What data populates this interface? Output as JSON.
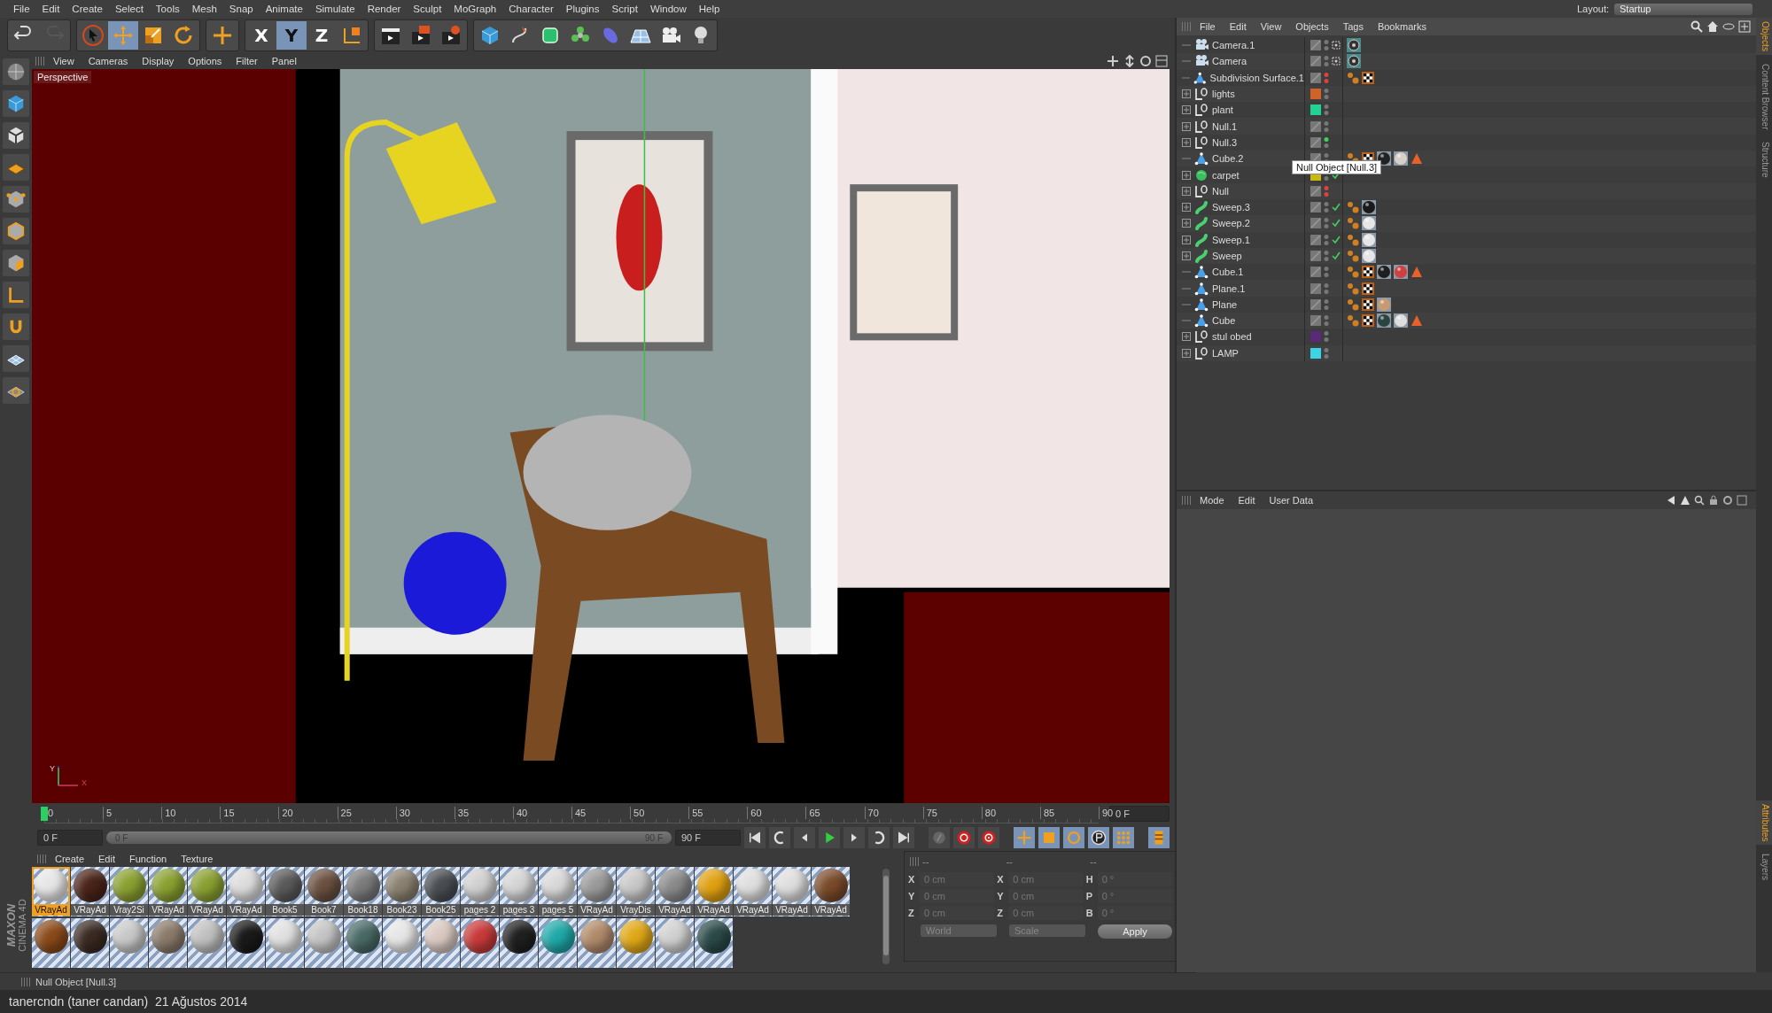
{
  "menubar": {
    "items": [
      "File",
      "Edit",
      "Create",
      "Select",
      "Tools",
      "Mesh",
      "Snap",
      "Animate",
      "Simulate",
      "Render",
      "Sculpt",
      "MoGraph",
      "Character",
      "Plugins",
      "Script",
      "Window",
      "Help"
    ],
    "layout_label": "Layout:",
    "layout_value": "Startup"
  },
  "toolbar": [
    {
      "kind": "undo",
      "selected": false,
      "disabled": false
    },
    {
      "kind": "redo",
      "selected": false,
      "disabled": true
    },
    {
      "kind": "sep"
    },
    {
      "kind": "select",
      "selected": false,
      "disabled": false
    },
    {
      "kind": "move",
      "selected": true,
      "disabled": false
    },
    {
      "kind": "scale",
      "selected": false,
      "disabled": false
    },
    {
      "kind": "rotate",
      "selected": false,
      "disabled": false
    },
    {
      "kind": "sep"
    },
    {
      "kind": "add",
      "selected": false,
      "disabled": false
    },
    {
      "kind": "sep"
    },
    {
      "kind": "axis",
      "label": "X",
      "selected": false,
      "disabled": false
    },
    {
      "kind": "axis",
      "label": "Y",
      "selected": true,
      "disabled": false
    },
    {
      "kind": "axis",
      "label": "Z",
      "selected": false,
      "disabled": false
    },
    {
      "kind": "coords",
      "selected": false,
      "disabled": false
    },
    {
      "kind": "sep"
    },
    {
      "kind": "render-view",
      "selected": false,
      "disabled": false
    },
    {
      "kind": "render-picture",
      "selected": false,
      "disabled": false
    },
    {
      "kind": "render-settings",
      "selected": false,
      "disabled": false
    },
    {
      "kind": "sep"
    },
    {
      "kind": "cube",
      "selected": false,
      "disabled": false
    },
    {
      "kind": "pen",
      "selected": false,
      "disabled": false
    },
    {
      "kind": "subdiv",
      "selected": false,
      "disabled": false
    },
    {
      "kind": "cloner",
      "selected": false,
      "disabled": false
    },
    {
      "kind": "deformer",
      "selected": false,
      "disabled": false
    },
    {
      "kind": "floor",
      "selected": false,
      "disabled": false
    },
    {
      "kind": "camera",
      "selected": false,
      "disabled": false
    },
    {
      "kind": "light",
      "selected": false,
      "disabled": false
    }
  ],
  "left_tools": [
    {
      "kind": "model"
    },
    {
      "kind": "cube"
    },
    {
      "kind": "texture"
    },
    {
      "kind": "workplane"
    },
    {
      "kind": "points"
    },
    {
      "kind": "edges"
    },
    {
      "kind": "polygons"
    },
    {
      "kind": "axis-l"
    },
    {
      "kind": "magnet"
    },
    {
      "kind": "snap"
    },
    {
      "kind": "lock"
    }
  ],
  "logo": {
    "line_1": "MAXON",
    "line_2": "CINEMA 4D"
  },
  "viewport": {
    "menu": [
      "View",
      "Cameras",
      "Display",
      "Options",
      "Filter",
      "Panel"
    ],
    "label": "Perspective",
    "axis": {
      "y": "Y",
      "x": "X"
    },
    "kind": "picture"
  },
  "timeline": {
    "ticks": [
      "0",
      "5",
      "10",
      "15",
      "20",
      "25",
      "30",
      "35",
      "40",
      "45",
      "50",
      "55",
      "60",
      "65",
      "70",
      "75",
      "80",
      "85",
      "90"
    ],
    "playhead": {
      "level": 0
    },
    "frame_field": "0 F",
    "start_field": "0 F",
    "range_start": "0 F",
    "range_end": "90 F",
    "end_field": "90 F",
    "buttons": [
      {
        "kind": "first",
        "selected": false
      },
      {
        "kind": "prev-key",
        "selected": false
      },
      {
        "kind": "prev-frame",
        "selected": false
      },
      {
        "kind": "play",
        "selected": false
      },
      {
        "kind": "next-frame",
        "selected": false
      },
      {
        "kind": "next-key",
        "selected": false
      },
      {
        "kind": "last",
        "selected": false
      },
      {
        "kind": "gap"
      },
      {
        "kind": "key",
        "selected": false
      },
      {
        "kind": "record",
        "selected": false
      },
      {
        "kind": "autokey",
        "selected": false
      },
      {
        "kind": "gap"
      },
      {
        "kind": "pos",
        "selected": true
      },
      {
        "kind": "scl",
        "selected": true
      },
      {
        "kind": "rot",
        "selected": true
      },
      {
        "kind": "param",
        "selected": true
      },
      {
        "kind": "pla",
        "selected": true
      },
      {
        "kind": "gap"
      },
      {
        "kind": "timeline",
        "selected": true
      }
    ]
  },
  "materials": {
    "menu": [
      "Create",
      "Edit",
      "Function",
      "Texture"
    ],
    "rows": [
      [
        {
          "label": "VRayAd",
          "color": "#e6e6e6",
          "selected": true
        },
        {
          "label": "VRayAd",
          "color": "#4a2418",
          "selected": false
        },
        {
          "label": "Vray2Si",
          "color": "#8aa030",
          "selected": false
        },
        {
          "label": "VRayAd",
          "color": "#8aa030",
          "selected": false
        },
        {
          "label": "VRayAd",
          "color": "#8aa030",
          "selected": false
        },
        {
          "label": "VRayAd",
          "color": "#dcdcdc",
          "selected": false
        },
        {
          "label": "Book5",
          "color": "#5a5a5a",
          "selected": false
        },
        {
          "label": "Book7",
          "color": "#6a5040",
          "selected": false
        },
        {
          "label": "Book18",
          "color": "#7a7a7a",
          "selected": false
        },
        {
          "label": "Book23",
          "color": "#8a8070",
          "selected": false
        },
        {
          "label": "Book25",
          "color": "#4a4e52",
          "selected": false
        },
        {
          "label": "pages 2",
          "color": "#d0d0d0",
          "selected": false
        },
        {
          "label": "pages 3",
          "color": "#d4d4d4",
          "selected": false
        },
        {
          "label": "pages 5",
          "color": "#d8d8d8",
          "selected": false
        },
        {
          "label": "VRayAd",
          "color": "#9a9a9a",
          "selected": false
        },
        {
          "label": "VrayDis",
          "color": "#c8c8c8",
          "selected": false
        },
        {
          "label": "VRayAd",
          "color": "#8a8a8a",
          "selected": false
        },
        {
          "label": "VRayAd",
          "color": "#e0a010",
          "selected": false
        },
        {
          "label": "VRayAd",
          "color": "#dedede",
          "selected": false
        },
        {
          "label": "VRayAd",
          "color": "#dedede",
          "selected": false
        },
        {
          "label": "VRayAd",
          "color": "#7a4a2a",
          "selected": false
        }
      ],
      [
        {
          "color": "#8a4a1a",
          "selected": false
        },
        {
          "color": "#3a2a22",
          "selected": false
        },
        {
          "color": "#c8c8c8",
          "selected": false
        },
        {
          "color": "#8a7a6a",
          "selected": false
        },
        {
          "color": "#c0c0c0",
          "selected": false
        },
        {
          "color": "#1a1a1a",
          "selected": false
        },
        {
          "color": "#e0e0e0",
          "selected": false
        },
        {
          "color": "#c4c4c4",
          "selected": false
        },
        {
          "color": "#4a6a66",
          "selected": false
        },
        {
          "color": "#e6e6e6",
          "selected": false
        },
        {
          "color": "#d8c8c0",
          "selected": false
        },
        {
          "color": "#c83a3a",
          "selected": false
        },
        {
          "color": "#202020",
          "selected": false
        },
        {
          "color": "#20a8a8",
          "selected": false
        },
        {
          "color": "#b08a6a",
          "selected": false
        },
        {
          "color": "#e0a818",
          "selected": false
        },
        {
          "color": "#d0d0d0",
          "selected": false
        },
        {
          "color": "#2a4a48",
          "selected": false
        }
      ]
    ]
  },
  "coordinates": {
    "headers": [
      "--",
      "--",
      "--"
    ],
    "rows": [
      {
        "a": "X",
        "a_val": "0 cm",
        "b": "X",
        "b_val": "0 cm",
        "c": "H",
        "c_val": "0 °"
      },
      {
        "a": "Y",
        "a_val": "0 cm",
        "b": "Y",
        "b_val": "0 cm",
        "c": "P",
        "c_val": "0 °"
      },
      {
        "a": "Z",
        "a_val": "0 cm",
        "b": "Z",
        "b_val": "0 cm",
        "c": "B",
        "c_val": "0 °"
      }
    ],
    "mode": "World",
    "size_mode": "Scale",
    "apply": "Apply"
  },
  "status_bar": "Null Object [Null.3]",
  "credit": "tanercndn (taner candan)  21 Ağustos 2014",
  "object_manager": {
    "menu": [
      "File",
      "Edit",
      "View",
      "Objects",
      "Tags",
      "Bookmarks"
    ],
    "objects": [
      {
        "name": "Camera.1",
        "kind": "camera",
        "expandable": false,
        "target": true,
        "editor_off": false,
        "render_off": false,
        "editor_on": false,
        "enabled": false,
        "tags": [
          {
            "kind": "camera"
          }
        ]
      },
      {
        "name": "Camera",
        "kind": "camera",
        "expandable": false,
        "target": true,
        "editor_off": false,
        "render_off": false,
        "editor_on": false,
        "enabled": false,
        "tags": [
          {
            "kind": "camera"
          }
        ]
      },
      {
        "name": "Subdivision Surface.1",
        "kind": "polygon",
        "expandable": false,
        "editor_off": true,
        "render_off": true,
        "editor_on": false,
        "enabled": false,
        "tags": [
          {
            "kind": "phong"
          },
          {
            "kind": "texture"
          }
        ]
      },
      {
        "name": "lights",
        "kind": "null",
        "expandable": true,
        "color": "#d0622a",
        "editor_off": false,
        "render_off": false,
        "editor_on": false,
        "enabled": false
      },
      {
        "name": "plant",
        "kind": "null",
        "expandable": true,
        "color": "#22d494",
        "editor_off": false,
        "render_off": false,
        "editor_on": false,
        "enabled": false
      },
      {
        "name": "Null.1",
        "kind": "null",
        "expandable": true,
        "editor_off": false,
        "render_off": false,
        "editor_on": false,
        "enabled": false
      },
      {
        "name": "Null.3",
        "kind": "null",
        "expandable": true,
        "editor_off": false,
        "render_off": false,
        "editor_on": true,
        "enabled": false
      },
      {
        "name": "Cube.2",
        "kind": "polygon",
        "expandable": false,
        "editor_off": false,
        "render_off": false,
        "editor_on": false,
        "enabled": false,
        "tags": [
          {
            "kind": "phong"
          },
          {
            "kind": "texture"
          },
          {
            "kind": "material",
            "color": "#222222"
          },
          {
            "kind": "material",
            "color": "#d8d0c8"
          },
          {
            "kind": "warning"
          }
        ]
      },
      {
        "name": "carpet",
        "kind": "carpet",
        "expandable": true,
        "color": "#c8b810",
        "editor_off": false,
        "render_off": false,
        "editor_on": false,
        "enabled": true
      },
      {
        "name": "Null",
        "kind": "null",
        "expandable": true,
        "editor_off": true,
        "render_off": true,
        "editor_on": false,
        "enabled": false
      },
      {
        "name": "Sweep.3",
        "kind": "sweep",
        "expandable": true,
        "editor_off": false,
        "render_off": false,
        "editor_on": false,
        "enabled": true,
        "tags": [
          {
            "kind": "phong"
          },
          {
            "kind": "material",
            "color": "#1a1a1a"
          }
        ]
      },
      {
        "name": "Sweep.2",
        "kind": "sweep",
        "expandable": true,
        "editor_off": false,
        "render_off": false,
        "editor_on": false,
        "enabled": true,
        "tags": [
          {
            "kind": "phong"
          },
          {
            "kind": "material",
            "color": "#e6e6e6"
          }
        ]
      },
      {
        "name": "Sweep.1",
        "kind": "sweep",
        "expandable": true,
        "editor_off": false,
        "render_off": false,
        "editor_on": false,
        "enabled": true,
        "tags": [
          {
            "kind": "phong"
          },
          {
            "kind": "material",
            "color": "#e6e6e6"
          }
        ]
      },
      {
        "name": "Sweep",
        "kind": "sweep",
        "expandable": true,
        "editor_off": false,
        "render_off": false,
        "editor_on": false,
        "enabled": true,
        "tags": [
          {
            "kind": "phong"
          },
          {
            "kind": "material",
            "color": "#e6e6e6"
          }
        ]
      },
      {
        "name": "Cube.1",
        "kind": "polygon",
        "expandable": false,
        "editor_off": false,
        "render_off": false,
        "editor_on": false,
        "enabled": false,
        "tags": [
          {
            "kind": "phong"
          },
          {
            "kind": "texture"
          },
          {
            "kind": "material",
            "color": "#1e1e1e"
          },
          {
            "kind": "material",
            "color": "#d04040"
          },
          {
            "kind": "warning"
          }
        ]
      },
      {
        "name": "Plane.1",
        "kind": "polygon",
        "expandable": false,
        "editor_off": false,
        "render_off": false,
        "editor_on": false,
        "enabled": false,
        "tags": [
          {
            "kind": "phong"
          },
          {
            "kind": "texture"
          }
        ]
      },
      {
        "name": "Plane",
        "kind": "polygon",
        "expandable": false,
        "editor_off": false,
        "render_off": false,
        "editor_on": false,
        "enabled": false,
        "tags": [
          {
            "kind": "phong"
          },
          {
            "kind": "texture"
          },
          {
            "kind": "material",
            "color": "#c89a70"
          }
        ]
      },
      {
        "name": "Cube",
        "kind": "polygon",
        "expandable": false,
        "editor_off": false,
        "render_off": false,
        "editor_on": false,
        "enabled": false,
        "tags": [
          {
            "kind": "phong"
          },
          {
            "kind": "texture"
          },
          {
            "kind": "material",
            "color": "#2a4440"
          },
          {
            "kind": "material",
            "color": "#dedede"
          },
          {
            "kind": "warning"
          }
        ]
      },
      {
        "name": "stul obed",
        "kind": "null",
        "expandable": true,
        "color": "#5a2a78",
        "editor_off": false,
        "render_off": false,
        "editor_on": false,
        "enabled": false
      },
      {
        "name": "LAMP",
        "kind": "null",
        "expandable": true,
        "color": "#3ad4e4",
        "editor_off": false,
        "render_off": false,
        "editor_on": false,
        "enabled": false
      }
    ],
    "tooltip": "Null Object [Null.3]"
  },
  "attributes": {
    "menu": [
      "Mode",
      "Edit",
      "User Data"
    ]
  },
  "side_tabs": {
    "top": [
      {
        "label": "Objects",
        "selected": true
      },
      {
        "label": "Content Browser",
        "selected": false
      },
      {
        "label": "Structure",
        "selected": false
      }
    ],
    "bottom": [
      {
        "label": "Attributes",
        "selected": true
      },
      {
        "label": "Layers",
        "selected": false
      }
    ]
  }
}
